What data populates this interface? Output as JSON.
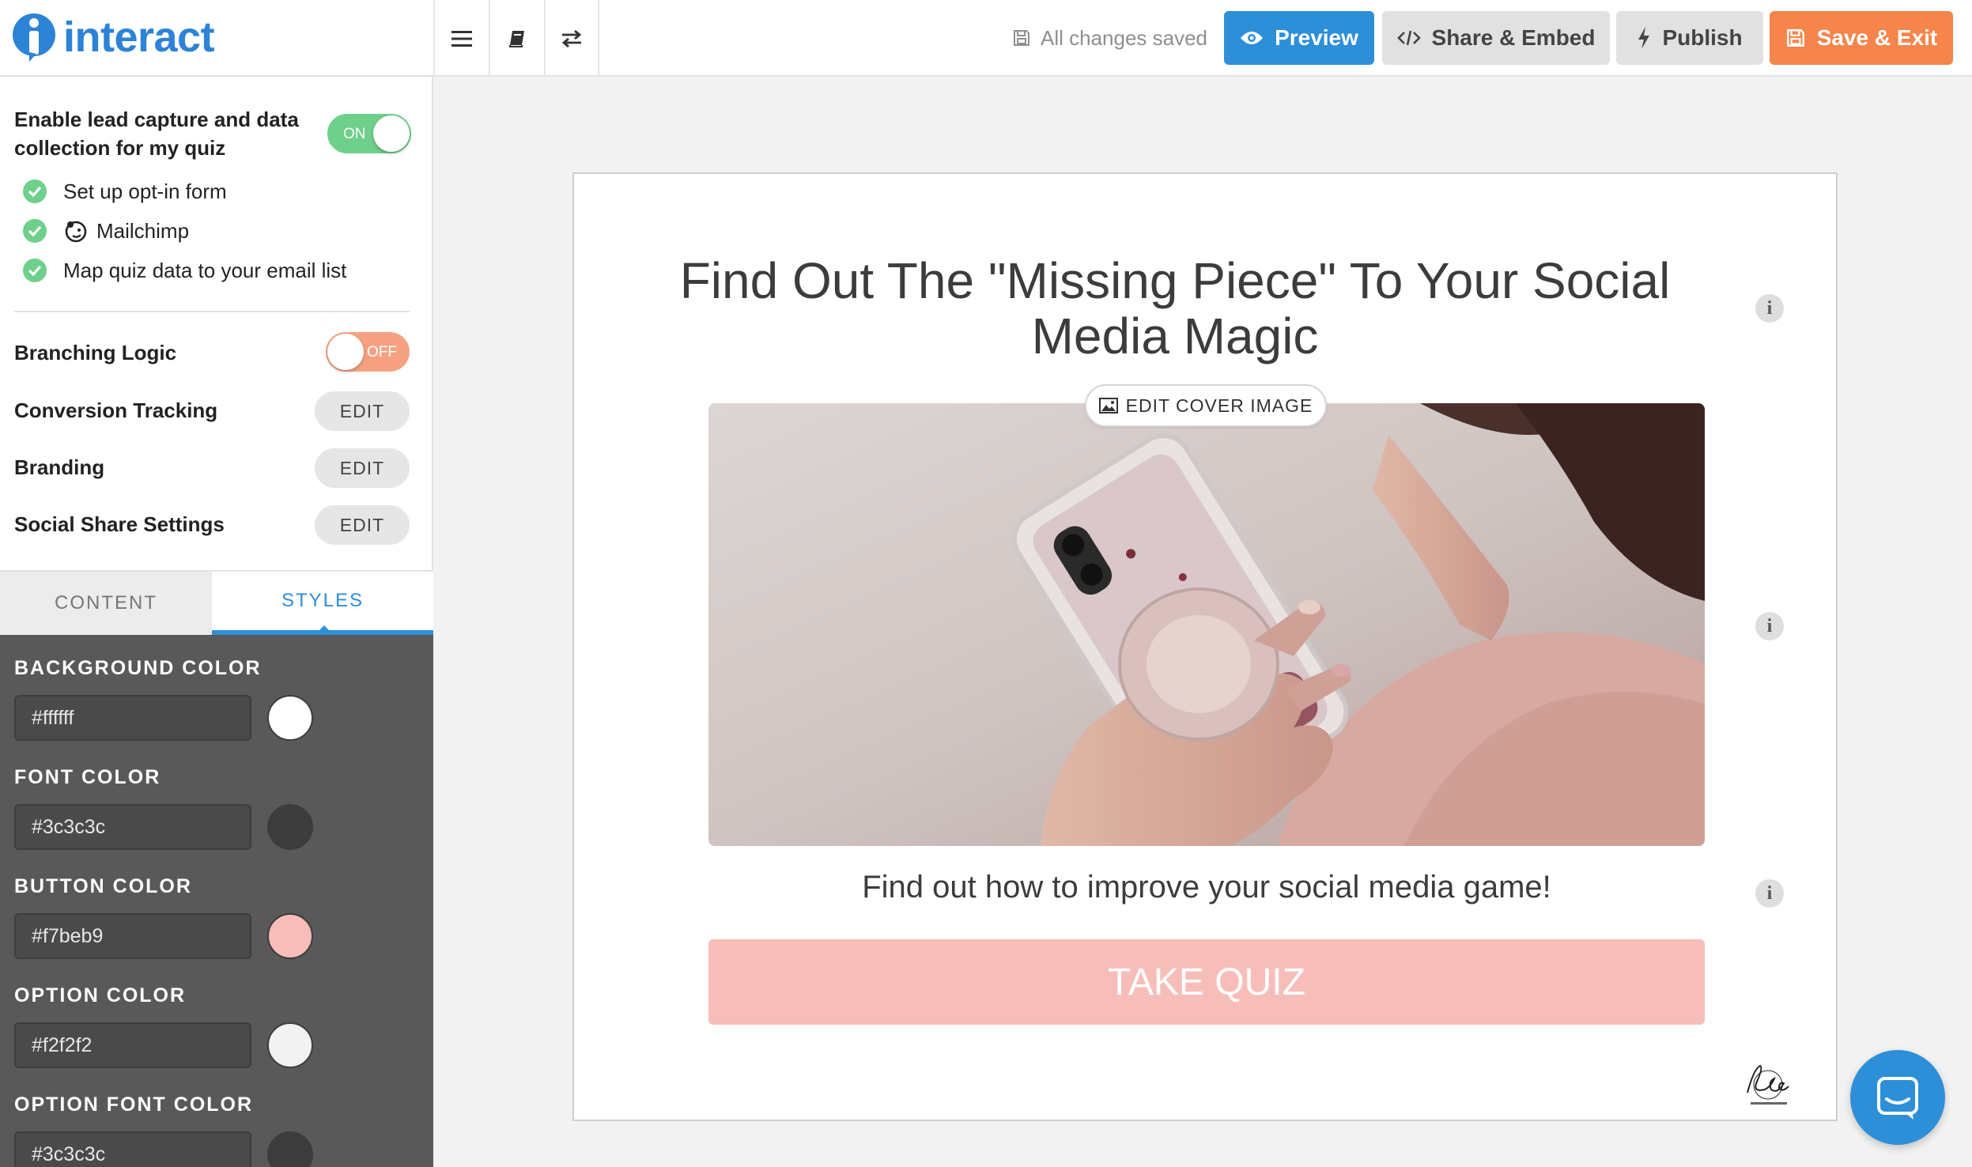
{
  "app": {
    "name": "interact",
    "brand_color": "#2d83d6"
  },
  "toolbar": {
    "saved_status": "All changes saved",
    "preview_label": "Preview",
    "share_label": "Share & Embed",
    "publish_label": "Publish",
    "save_exit_label": "Save & Exit",
    "icons": [
      "menu-icon",
      "book-icon",
      "swap-icon"
    ]
  },
  "sidebar": {
    "lead_capture": {
      "label": "Enable lead capture and data collection for my quiz",
      "toggle": "ON",
      "steps": [
        "Set up opt-in form",
        "Mailchimp",
        "Map quiz data to your email list"
      ]
    },
    "branching": {
      "label": "Branching Logic",
      "toggle": "OFF"
    },
    "settings": [
      {
        "label": "Conversion Tracking",
        "action": "EDIT"
      },
      {
        "label": "Branding",
        "action": "EDIT"
      },
      {
        "label": "Social Share Settings",
        "action": "EDIT"
      }
    ],
    "tabs": {
      "content": "CONTENT",
      "styles": "STYLES",
      "active": "styles"
    },
    "styles": [
      {
        "label": "BACKGROUND COLOR",
        "value": "#ffffff"
      },
      {
        "label": "FONT COLOR",
        "value": "#3c3c3c"
      },
      {
        "label": "BUTTON COLOR",
        "value": "#f7beb9"
      },
      {
        "label": "OPTION COLOR",
        "value": "#f2f2f2"
      },
      {
        "label": "OPTION FONT COLOR",
        "value": "#3c3c3c"
      }
    ]
  },
  "quiz": {
    "title": "Find Out The \"Missing Piece\" To Your Social Media Magic",
    "edit_cover_label": "EDIT COVER IMAGE",
    "subtitle": "Find out how to improve your social media game!",
    "button_label": "TAKE QUIZ"
  }
}
